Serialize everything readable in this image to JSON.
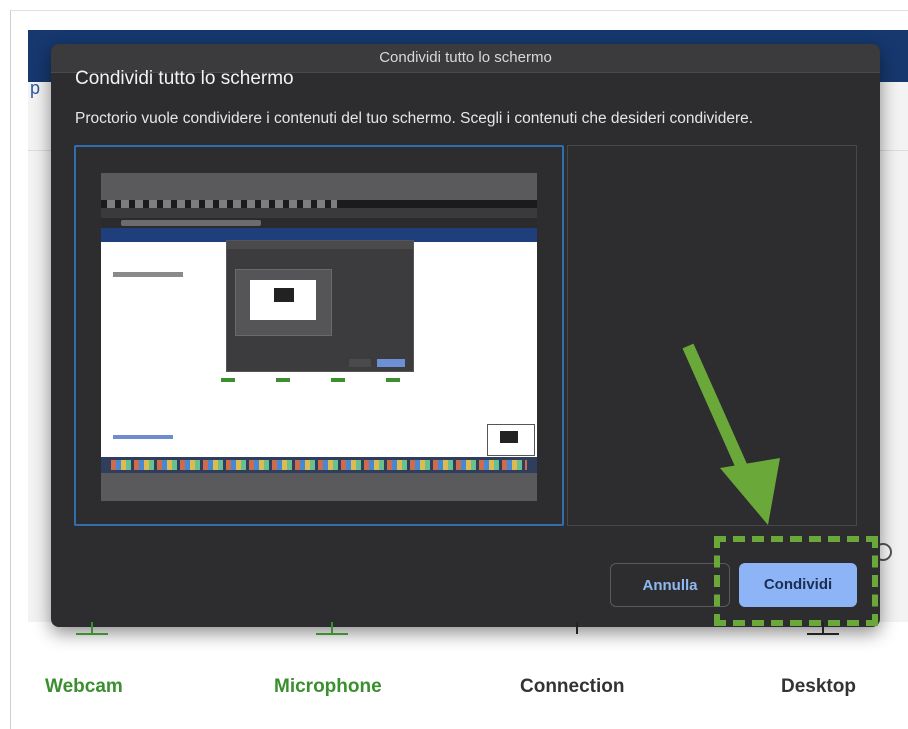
{
  "dialog": {
    "window_title": "Condividi tutto lo schermo",
    "heading": "Condividi tutto lo schermo",
    "description": "Proctorio vuole condividere i contenuti del tuo schermo. Scegli i contenuti che desideri condividere.",
    "cancel_label": "Annulla",
    "share_label": "Condividi"
  },
  "background": {
    "partial_letter": "p",
    "checks": [
      {
        "label": "Webcam",
        "color": "#3b8f2f"
      },
      {
        "label": "Microphone",
        "color": "#3b8f2f"
      },
      {
        "label": "Connection",
        "color": "#333333"
      },
      {
        "label": "Desktop",
        "color": "#333333"
      }
    ]
  },
  "annotation": {
    "arrow_color": "#6aa83a",
    "highlight_color": "#6aa83a"
  }
}
